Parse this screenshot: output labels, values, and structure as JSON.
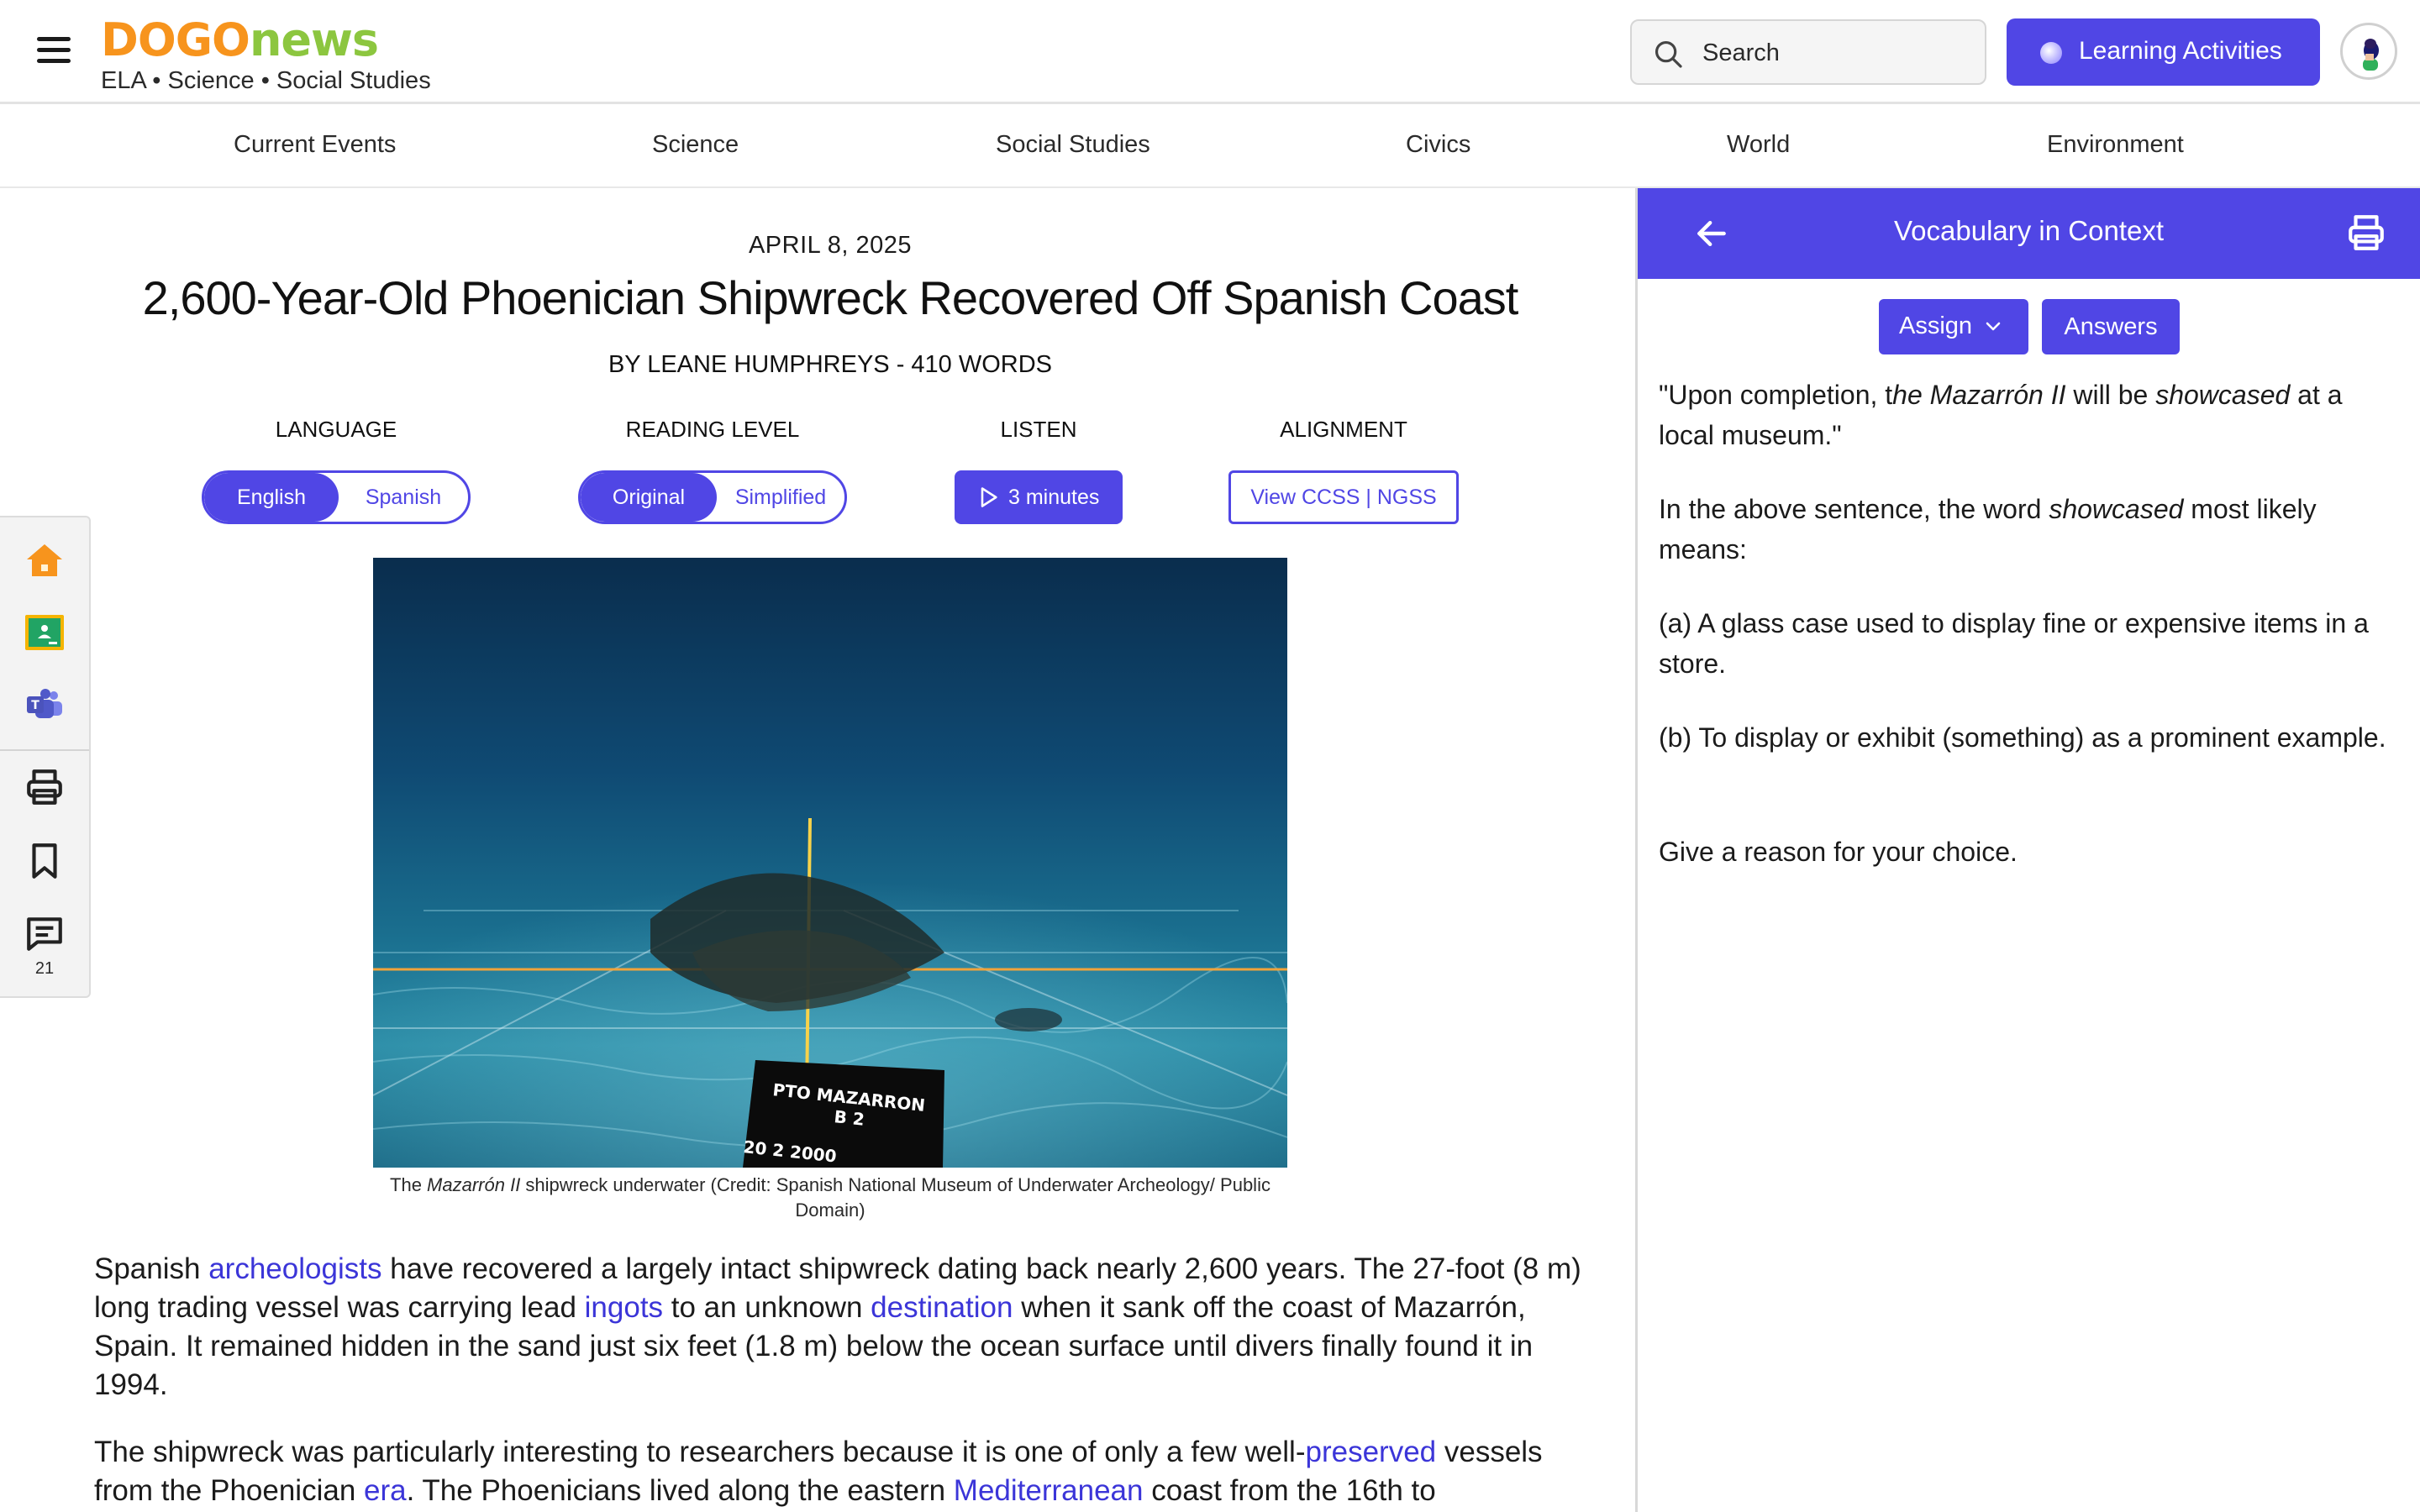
{
  "header": {
    "logo_part1": "DOGO",
    "logo_part2": "news",
    "tagline": "ELA • Science • Social Studies",
    "search_placeholder": "Search",
    "learning_activities_label": "Learning Activities",
    "brand_color": "#5046e5",
    "logo_colors": {
      "dogo": "#f7941d",
      "news": "#8cc63f"
    }
  },
  "nav": {
    "items": [
      "Current Events",
      "Science",
      "Social Studies",
      "Civics",
      "World",
      "Environment"
    ]
  },
  "sidebar": {
    "icons": [
      "home-icon",
      "google-classroom-icon",
      "teams-icon",
      "print-icon",
      "bookmark-icon",
      "comment-icon"
    ],
    "comment_count": "21"
  },
  "article": {
    "date": "APRIL 8, 2025",
    "title": "2,600-Year-Old Phoenician Shipwreck Recovered Off Spanish Coast",
    "byline": "BY LEANE HUMPHREYS - 410 WORDS",
    "controls": {
      "language_label": "LANGUAGE",
      "language_options": [
        "English",
        "Spanish"
      ],
      "language_selected": "English",
      "reading_level_label": "READING LEVEL",
      "reading_level_options": [
        "Original",
        "Simplified"
      ],
      "reading_level_selected": "Original",
      "listen_label": "LISTEN",
      "listen_button": "3 minutes",
      "alignment_label": "ALIGNMENT",
      "alignment_button": "View CCSS | NGSS"
    },
    "photo_sign": {
      "line1": "PTO  MAZARRON",
      "line2": "B 2",
      "line3": "20  2  2000"
    },
    "caption": {
      "prefix": "The ",
      "italic": "Mazarrón II",
      "rest": " shipwreck underwater (Credit: Spanish National Museum of Underwater Archeology/ Public Domain)"
    },
    "paragraph1": {
      "t1": "Spanish ",
      "v1": "archeologists",
      "t2": " have recovered a largely intact shipwreck dating back nearly 2,600 years. The 27-foot (8 m) long trading vessel was carrying lead ",
      "v2": "ingots",
      "t3": " to an unknown ",
      "v3": "destination",
      "t4": " when it sank off the coast of Mazarrón, Spain. It remained hidden in the sand just six feet (1.8 m) below the ocean surface until divers finally found it in 1994."
    },
    "paragraph2": {
      "t1": "The shipwreck was particularly interesting to researchers because it is one of only a few well-",
      "v1": "preserved",
      "t2": " vessels from the Phoenician ",
      "v2": "era",
      "t3": ". The Phoenicians lived along the eastern ",
      "v3": "Mediterranean",
      "t4": " coast from the 16th to"
    }
  },
  "panel": {
    "title": "Vocabulary in Context",
    "assign_label": "Assign",
    "answers_label": "Answers",
    "quote": {
      "q1": "\"Upon completion, t",
      "q2": "he Mazarrón II",
      "q3": " will be ",
      "q4": "showcased",
      "q5": " at a local museum.\""
    },
    "question": {
      "p1": "In the above sentence, the word ",
      "p2": "showcased",
      "p3": " most likely means:"
    },
    "option_a": "(a) A glass case used to display fine or expensive items in a store.",
    "option_b": "(b) To display or exhibit (something) as a prominent example.",
    "instruction": "Give a reason for your choice."
  }
}
